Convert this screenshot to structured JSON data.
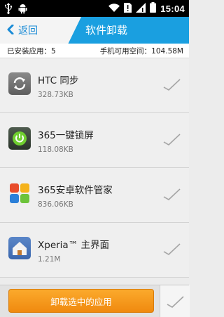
{
  "status_bar": {
    "time": "15:04",
    "icons": [
      "usb-icon",
      "android-icon",
      "wifi-icon",
      "no-sim-icon",
      "signal-icon",
      "battery-icon"
    ]
  },
  "header": {
    "back_label": "返回",
    "title": "软件卸载",
    "accent_color": "#1a9fe0"
  },
  "info_bar": {
    "installed_count": "已安装应用：5",
    "free_space": "手机可用空间：104.58M"
  },
  "apps": [
    {
      "name": "HTC 同步",
      "size": "328.73KB",
      "icon": "sync-icon",
      "checked": false
    },
    {
      "name": "365一键锁屏",
      "size": "118.08KB",
      "icon": "power-lock-icon",
      "checked": false
    },
    {
      "name": "365安卓软件管家",
      "size": "836.06KB",
      "icon": "cube-icon",
      "checked": false
    },
    {
      "name": "Xperia™ 主界面",
      "size": "1.21M",
      "icon": "home-icon",
      "checked": false
    }
  ],
  "bottom": {
    "uninstall_label": "卸载选中的应用",
    "button_color": "#f5961c"
  }
}
